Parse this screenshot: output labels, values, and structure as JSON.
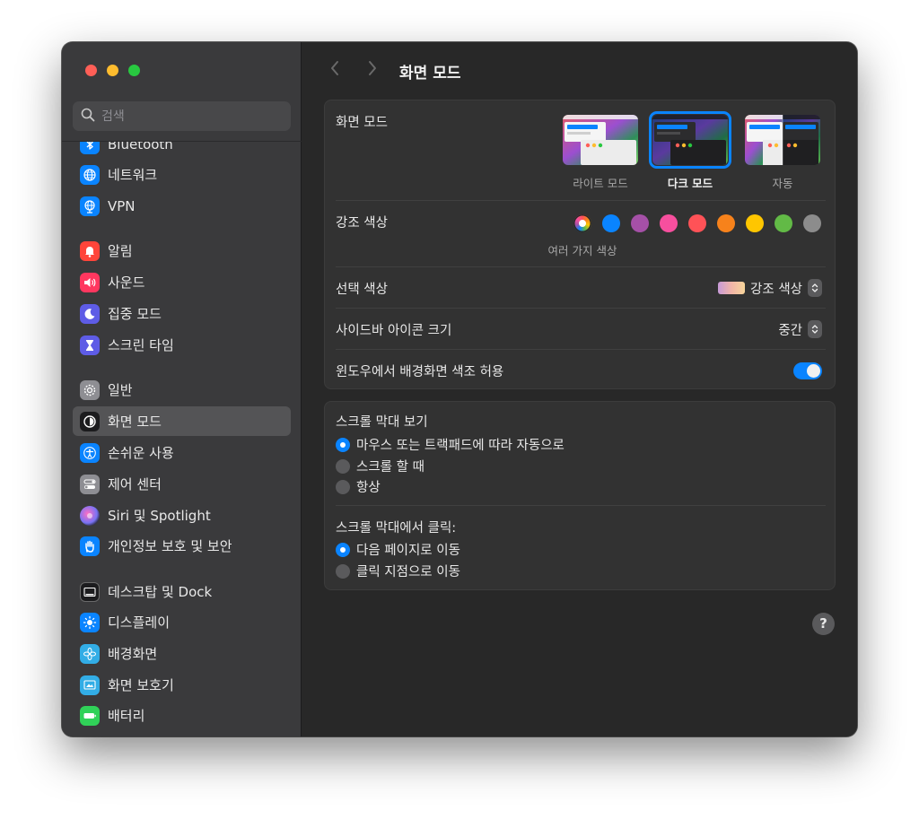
{
  "search": {
    "placeholder": "검색"
  },
  "sidebar": {
    "items": [
      {
        "label": "Bluetooth",
        "icon": "bluetooth-icon",
        "color": "#0a84ff"
      },
      {
        "label": "네트워크",
        "icon": "globe-icon",
        "color": "#0a84ff"
      },
      {
        "label": "VPN",
        "icon": "vpn-globe-icon",
        "color": "#0a84ff"
      },
      {
        "label": "알림",
        "icon": "bell-icon",
        "color": "#ff453a"
      },
      {
        "label": "사운드",
        "icon": "speaker-icon",
        "color": "#ff375f"
      },
      {
        "label": "집중 모드",
        "icon": "moon-icon",
        "color": "#5e5ce6"
      },
      {
        "label": "스크린 타임",
        "icon": "hourglass-icon",
        "color": "#5e5ce6"
      },
      {
        "label": "일반",
        "icon": "gear-icon",
        "color": "#8e8e93"
      },
      {
        "label": "화면 모드",
        "icon": "appearance-icon",
        "color": "#1c1c1e",
        "selected": true
      },
      {
        "label": "손쉬운 사용",
        "icon": "accessibility-icon",
        "color": "#0a84ff"
      },
      {
        "label": "제어 센터",
        "icon": "control-center-icon",
        "color": "#8e8e93"
      },
      {
        "label": "Siri 및 Spotlight",
        "icon": "siri-icon",
        "color": "#bf5af2"
      },
      {
        "label": "개인정보 보호 및 보안",
        "icon": "hand-icon",
        "color": "#0a84ff"
      },
      {
        "label": "데스크탑 및 Dock",
        "icon": "dock-icon",
        "color": "#1c1c1e"
      },
      {
        "label": "디스플레이",
        "icon": "sun-icon",
        "color": "#0a84ff"
      },
      {
        "label": "배경화면",
        "icon": "flower-icon",
        "color": "#32ade6"
      },
      {
        "label": "화면 보호기",
        "icon": "screensaver-icon",
        "color": "#32ade6"
      },
      {
        "label": "배터리",
        "icon": "battery-icon",
        "color": "#30d158"
      }
    ]
  },
  "main": {
    "title": "화면 모드",
    "appearance": {
      "label": "화면 모드",
      "options": [
        "라이트 모드",
        "다크 모드",
        "자동"
      ],
      "selected": "다크 모드"
    },
    "accent": {
      "label": "강조 색상",
      "caption": "여러 가지 색상",
      "colors": [
        "multicolor",
        "#0a84ff",
        "#a550a7",
        "#f74f9e",
        "#ff5257",
        "#f7821b",
        "#ffc600",
        "#62ba46",
        "#8c8c8c"
      ],
      "selected": "multicolor"
    },
    "highlight": {
      "label": "선택 색상",
      "value": "강조 색상"
    },
    "sidebar_icon_size": {
      "label": "사이드바 아이콘 크기",
      "value": "중간"
    },
    "wallpaper_tinting": {
      "label": "윈도우에서 배경화면 색조 허용",
      "enabled": true
    },
    "show_scroll_bars": {
      "label": "스크롤 막대 보기",
      "options": [
        "마우스 또는 트랙패드에 따라 자동으로",
        "스크롤 할 때",
        "항상"
      ],
      "selected": 0
    },
    "click_scroll_bar": {
      "label": "스크롤 막대에서 클릭:",
      "options": [
        "다음 페이지로 이동",
        "클릭 지점으로 이동"
      ],
      "selected": 0
    },
    "help": "?"
  }
}
